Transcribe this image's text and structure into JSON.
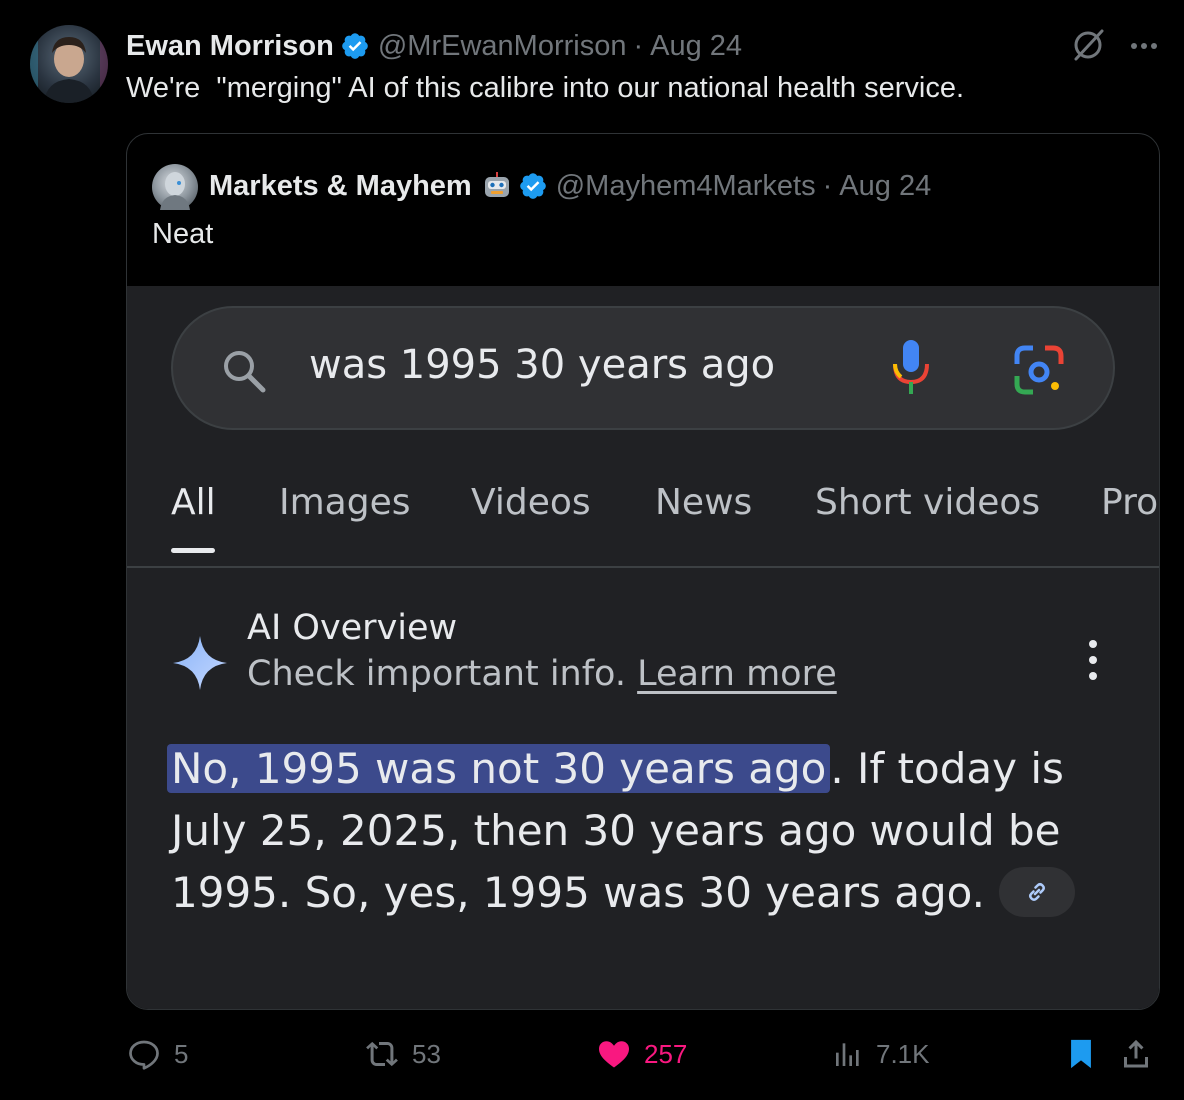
{
  "post": {
    "author_name": "Ewan Morrison",
    "handle": "@MrEwanMorrison",
    "date": "Aug 24",
    "text": "We're  \"merging\" AI of this calibre into our national health service.",
    "colors": {
      "verified": "#1d9bf0",
      "like": "#f91880",
      "bookmark": "#1d9bf0"
    }
  },
  "quote": {
    "author_name": "Markets & Mayhem",
    "handle": "@Mayhem4Markets",
    "date": "Aug 24",
    "text": "Neat",
    "screenshot": {
      "search_query": "was 1995 30 years ago",
      "tabs": [
        "All",
        "Images",
        "Videos",
        "News",
        "Short videos",
        "Pro"
      ],
      "active_tab": "All",
      "ai_overview_title": "AI Overview",
      "ai_overview_sub": "Check important info.",
      "ai_overview_link": "Learn more",
      "answer_highlight": "No, 1995 was not 30 years ago",
      "answer_rest": ". If today is July 25, 2025, then 30 years ago would be 1995. So, yes, 1995 was 30 years ago."
    }
  },
  "actions": {
    "replies": "5",
    "reposts": "53",
    "likes": "257",
    "views": "7.1K"
  }
}
